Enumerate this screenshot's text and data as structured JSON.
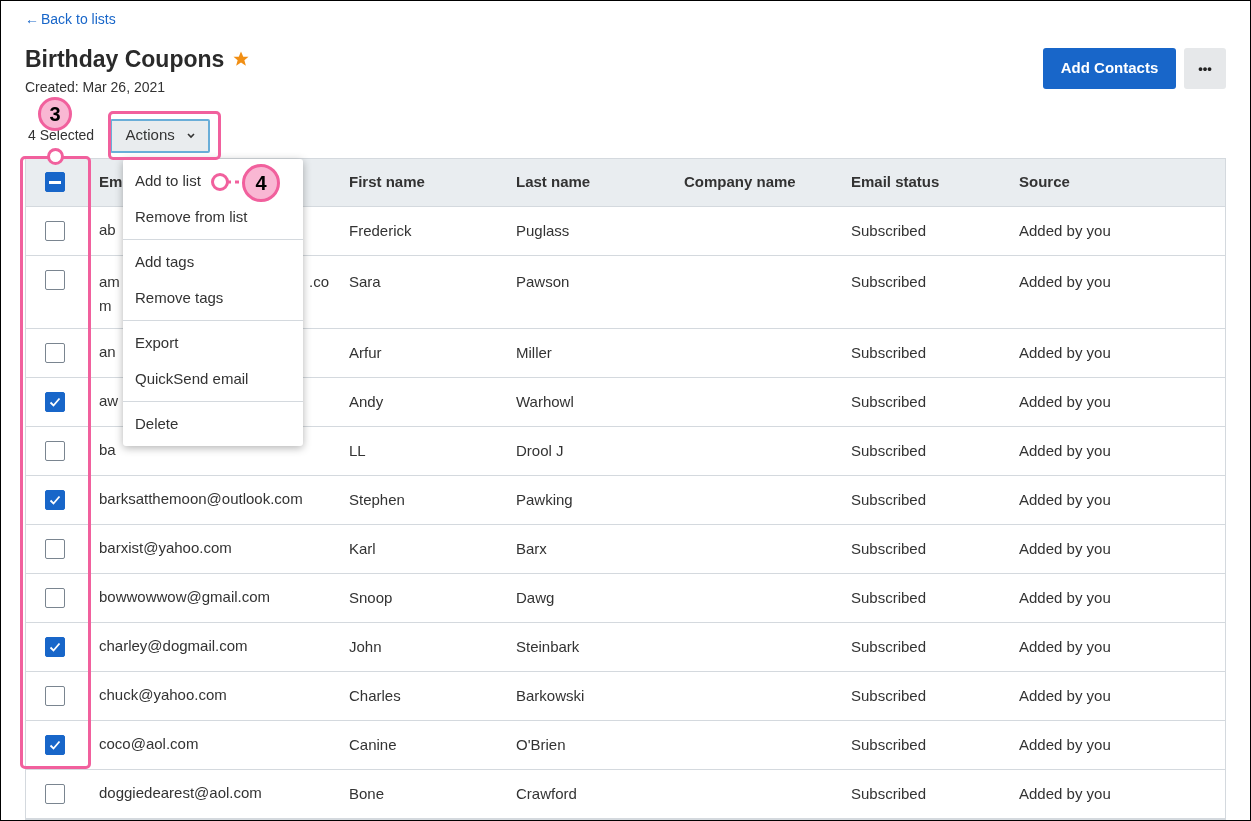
{
  "back_link": {
    "arrow": "←",
    "label": "Back to lists"
  },
  "list": {
    "title": "Birthday Coupons",
    "starred": true,
    "created": "Created: Mar 26, 2021"
  },
  "header_buttons": {
    "primary": "Add Contacts",
    "more": "•••"
  },
  "selection": {
    "count": "4 Selected",
    "actions": "Actions"
  },
  "actions_menu": {
    "groups": [
      [
        "Add to list",
        "Remove from list"
      ],
      [
        "Add tags",
        "Remove tags"
      ],
      [
        "Export",
        "QuickSend email"
      ],
      [
        "Delete"
      ]
    ]
  },
  "annotations": [
    {
      "label": "3"
    },
    {
      "label": "4"
    }
  ],
  "table": {
    "select_all_indeterminate": true,
    "columns": [
      "Em",
      "First name",
      "Last name",
      "Company name",
      "Email status",
      "Source"
    ],
    "rows": [
      {
        "checked": false,
        "email": "ab",
        "first": "Frederick",
        "last": "Puglass",
        "status": "Subscribed",
        "source": "Added by you"
      },
      {
        "checked": false,
        "email": "am",
        "email_right": ".co",
        "email_wrap": "m",
        "first": "Sara",
        "last": "Pawson",
        "status": "Subscribed",
        "source": "Added by you"
      },
      {
        "checked": false,
        "email": "an",
        "first": "Arfur",
        "last": "Miller",
        "status": "Subscribed",
        "source": "Added by you"
      },
      {
        "checked": true,
        "email": "aw",
        "first": "Andy",
        "last": "Warhowl",
        "status": "Subscribed",
        "source": "Added by you"
      },
      {
        "checked": false,
        "email": "ba",
        "first": "LL",
        "last": "Drool J",
        "status": "Subscribed",
        "source": "Added by you"
      },
      {
        "checked": true,
        "email": "barksatthemoon@outlook.com",
        "first": "Stephen",
        "last": "Pawking",
        "status": "Subscribed",
        "source": "Added by you"
      },
      {
        "checked": false,
        "email": "barxist@yahoo.com",
        "first": "Karl",
        "last": "Barx",
        "status": "Subscribed",
        "source": "Added by you"
      },
      {
        "checked": false,
        "email": "bowwowwow@gmail.com",
        "first": "Snoop",
        "last": "Dawg",
        "status": "Subscribed",
        "source": "Added by you"
      },
      {
        "checked": true,
        "email": "charley@dogmail.com",
        "first": "John",
        "last": "Steinbark",
        "status": "Subscribed",
        "source": "Added by you"
      },
      {
        "checked": false,
        "email": "chuck@yahoo.com",
        "first": "Charles",
        "last": "Barkowski",
        "status": "Subscribed",
        "source": "Added by you"
      },
      {
        "checked": true,
        "email": "coco@aol.com",
        "first": "Canine",
        "last": "O'Brien",
        "status": "Subscribed",
        "source": "Added by you"
      },
      {
        "checked": false,
        "email": "doggiedearest@aol.com",
        "first": "Bone",
        "last": "Crawford",
        "status": "Subscribed",
        "source": "Added by you"
      }
    ]
  }
}
